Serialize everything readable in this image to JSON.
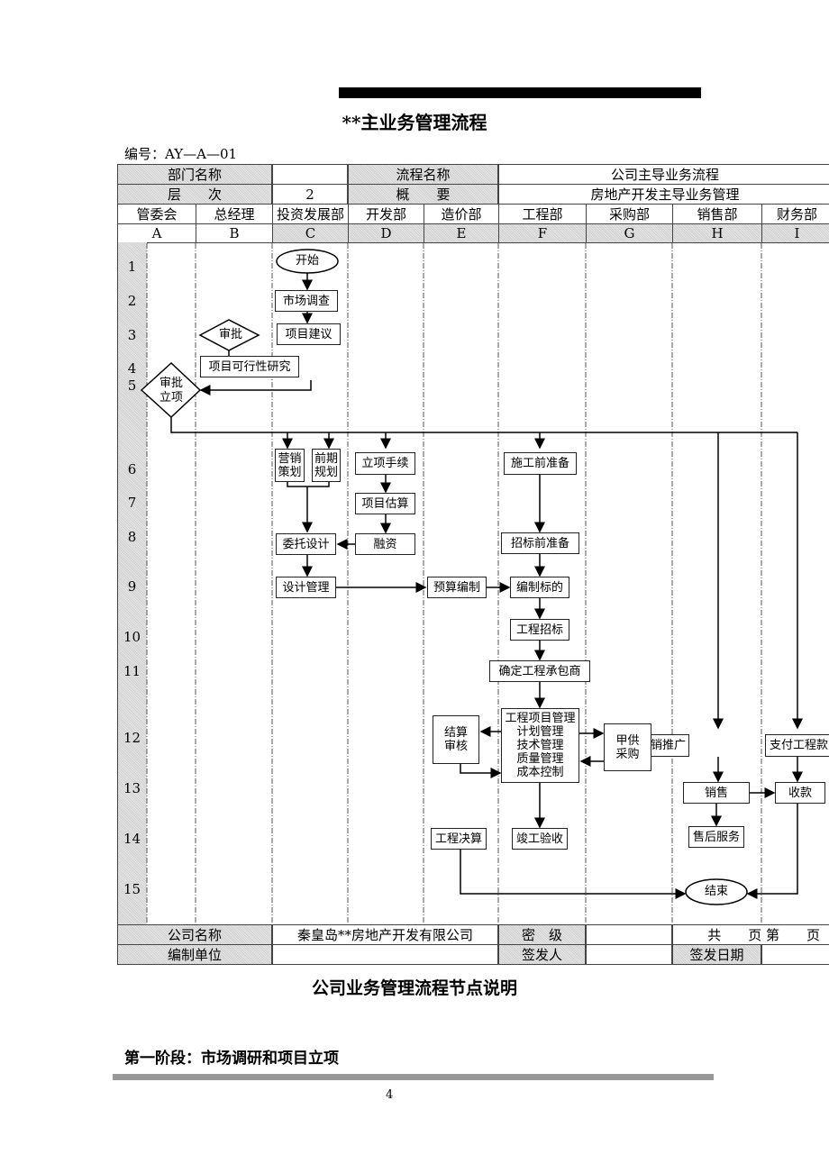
{
  "doc": {
    "title": "**主业务管理流程",
    "code": "编号：AY—A—01",
    "section_title": "公司业务管理流程节点说明",
    "phase": "第一阶段：市场调研和项目立项",
    "page_number": "4"
  },
  "header": {
    "dept_label": "部门名称",
    "dept_value": "",
    "flow_label": "流程名称",
    "flow_value": "公司主导业务流程",
    "level_label": "层　　次",
    "level_value": "2",
    "summary_label": "概　　要",
    "summary_value": "房地产开发主导业务管理",
    "departments": [
      "管委会",
      "总经理",
      "投资发展部",
      "开发部",
      "造价部",
      "工程部",
      "采购部",
      "销售部",
      "财务部"
    ],
    "letters": [
      "A",
      "B",
      "C",
      "D",
      "E",
      "F",
      "G",
      "H",
      "I"
    ]
  },
  "rows": [
    "1",
    "2",
    "3",
    "4",
    "5",
    "6",
    "7",
    "8",
    "9",
    "10",
    "11",
    "12",
    "13",
    "14",
    "15"
  ],
  "nodes": {
    "start": "开始",
    "market": "市场调查",
    "proposal": "项目建议",
    "approve": "审批",
    "feasibility": "项目可行性研究",
    "approve_project": [
      "审批",
      "立项"
    ],
    "marketing_plan": [
      "营销",
      "策划"
    ],
    "early_plan": [
      "前期",
      "规划"
    ],
    "setup": "立项手续",
    "pre_construction": "施工前准备",
    "estimate": "项目估算",
    "commission_design": "委托设计",
    "financing": "融资",
    "pre_tender": "招标前准备",
    "design_mgmt": "设计管理",
    "budget": "预算编制",
    "tender_doc": "编制标的",
    "tender": "工程招标",
    "contractor": "确定工程承包商",
    "project_mgmt": [
      "工程项目管理",
      "计划管理",
      "技术管理",
      "质量管理",
      "成本控制"
    ],
    "settlement": [
      "结算",
      "审核"
    ],
    "procurement": [
      "甲供",
      "采购"
    ],
    "promotion": "销推广",
    "payment": "支付工程款",
    "sales": "销售",
    "collection": "收款",
    "final_account": "工程决算",
    "acceptance": "竣工验收",
    "after_sales": "售后服务",
    "end": "结束"
  },
  "footer": {
    "company_label": "公司名称",
    "company_value": "秦皇岛**房地产开发有限公司",
    "secret_label": "密　级",
    "secret_value": "",
    "pages": "共　　页 第　　页",
    "unit_label": "编制单位",
    "unit_value": "",
    "signer_label": "签发人",
    "signer_value": "",
    "date_label": "签发日期",
    "date_value": ""
  }
}
